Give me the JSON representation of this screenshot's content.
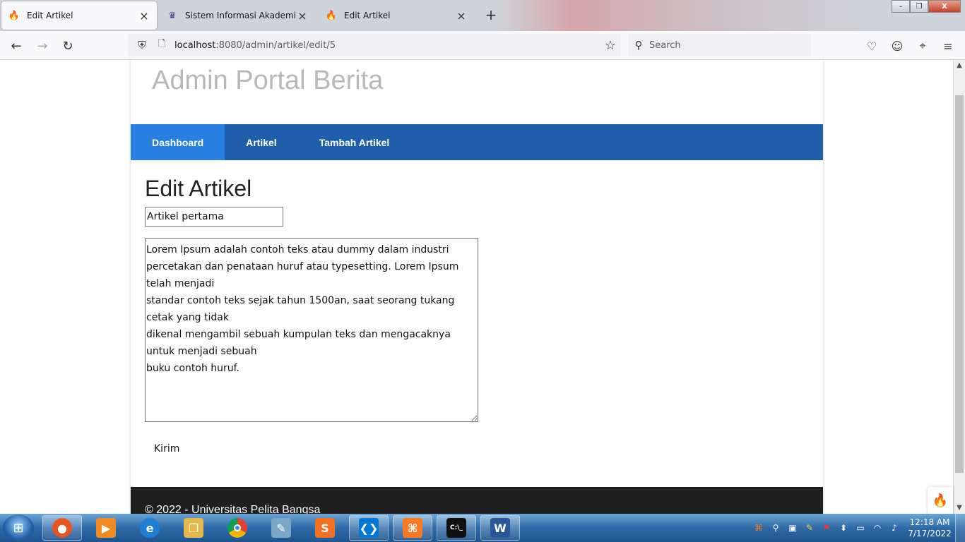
{
  "browser": {
    "tabs": [
      {
        "label": "Edit Artikel",
        "icon": "codeigniter-flame-icon",
        "active": true
      },
      {
        "label": "Sistem Informasi Akademik",
        "icon": "university-logo-icon",
        "active": false
      },
      {
        "label": "Edit Artikel",
        "icon": "codeigniter-flame-icon",
        "active": false
      }
    ],
    "new_tab_symbol": "+",
    "url_host": "localhost",
    "url_path": ":8080/admin/artikel/edit/5",
    "search_placeholder": "Search"
  },
  "site": {
    "title": "Admin Portal Berita",
    "menu": [
      {
        "label": "Dashboard",
        "active": true
      },
      {
        "label": "Artikel",
        "active": false
      },
      {
        "label": "Tambah Artikel",
        "active": false
      }
    ],
    "footer": "© 2022 - Universitas Pelita Bangsa"
  },
  "form": {
    "heading": "Edit Artikel",
    "title_value": "Artikel pertama",
    "body_value": "Lorem Ipsum adalah contoh teks atau dummy dalam industri percetakan dan penataan huruf atau typesetting. Lorem Ipsum telah menjadi\nstandar contoh teks sejak tahun 1500an, saat seorang tukang cetak yang tidak\ndikenal mengambil sebuah kumpulan teks dan mengacaknya untuk menjadi sebuah\nbuku contoh huruf.",
    "submit_label": "Kirim"
  },
  "taskbar": {
    "apps": [
      {
        "name": "firefox",
        "running": true,
        "color": "#e8541f"
      },
      {
        "name": "media-player",
        "running": false,
        "color": "#f08a24"
      },
      {
        "name": "internet-explorer",
        "running": false,
        "color": "#1e7fd6"
      },
      {
        "name": "file-explorer",
        "running": false,
        "color": "#e5b84a"
      },
      {
        "name": "chrome",
        "running": false,
        "color": "#db4437"
      },
      {
        "name": "notepad",
        "running": false,
        "color": "#7aa7c7"
      },
      {
        "name": "sublime-text",
        "running": false,
        "color": "#f37021"
      },
      {
        "name": "vscode",
        "running": true,
        "color": "#0078d4"
      },
      {
        "name": "xampp",
        "running": true,
        "color": "#fb7a24"
      },
      {
        "name": "command-prompt",
        "running": true,
        "color": "#111111"
      },
      {
        "name": "word",
        "running": true,
        "color": "#2b579a"
      }
    ],
    "clock_time": "12:18 AM",
    "clock_date": "7/17/2022"
  },
  "colors": {
    "menu_bg": "#1f5fa9",
    "menu_active": "#2a80e0",
    "footer_bg": "#1f1f1f",
    "title_gray": "#b8b8b8"
  }
}
